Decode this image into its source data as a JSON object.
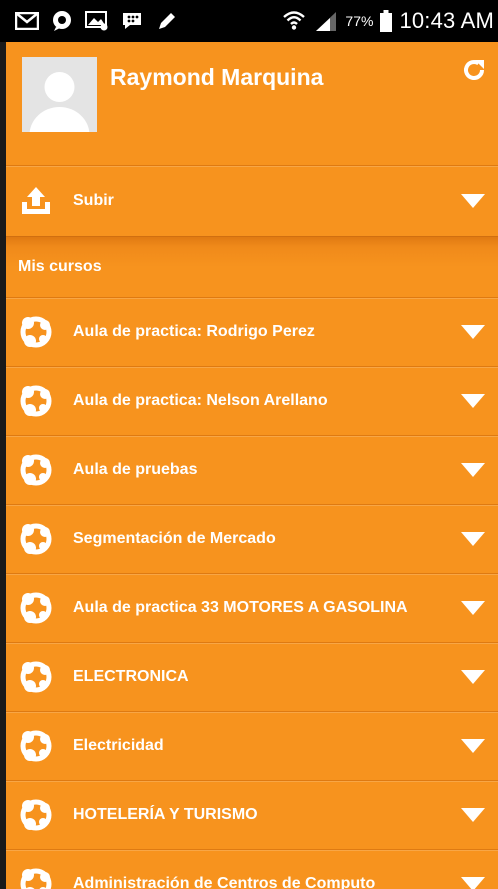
{
  "status_bar": {
    "battery_percent": "77%",
    "time": "10:43 AM",
    "icons": [
      "gmail-icon",
      "chat-bubble-icon",
      "message-image-icon",
      "bbm-icon",
      "pencil-icon",
      "wifi-icon",
      "signal-icon",
      "battery-icon"
    ]
  },
  "header": {
    "user_name": "Raymond Marquina",
    "avatar_icon": "default-avatar-icon",
    "refresh_icon": "refresh-icon"
  },
  "upload": {
    "label": "Subir",
    "icon": "upload-icon"
  },
  "section": {
    "title": "Mis cursos"
  },
  "courses": [
    {
      "label": "Aula de practica: Rodrigo Perez"
    },
    {
      "label": "Aula de practica: Nelson Arellano"
    },
    {
      "label": "Aula de pruebas"
    },
    {
      "label": "Segmentación de Mercado"
    },
    {
      "label": "Aula de practica 33 MOTORES A GASOLINA"
    },
    {
      "label": "ELECTRONICA"
    },
    {
      "label": "Electricidad"
    },
    {
      "label": "HOTELERÍA Y TURISMO"
    },
    {
      "label": "Administración de Centros de Computo"
    }
  ],
  "colors": {
    "drawer": "#F7931E",
    "divider": "#DE7A12",
    "text": "#FFFFFF",
    "status_bar": "#000000"
  }
}
